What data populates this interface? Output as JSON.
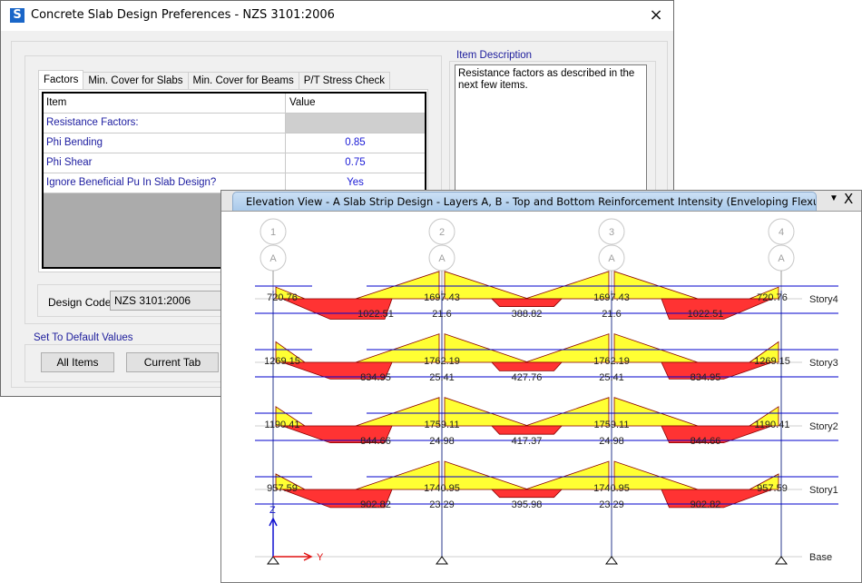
{
  "dialog": {
    "icon": "S",
    "title": "Concrete Slab Design Preferences - NZS 3101:2006",
    "close_icon": "×",
    "tabs": [
      {
        "label": "Factors",
        "active": true
      },
      {
        "label": "Min. Cover for Slabs",
        "active": false
      },
      {
        "label": "Min. Cover for Beams",
        "active": false
      },
      {
        "label": "P/T Stress Check",
        "active": false
      }
    ],
    "grid": {
      "headers": {
        "item": "Item",
        "value": "Value"
      },
      "rows": [
        {
          "item": "Resistance Factors:",
          "value": ""
        },
        {
          "item": "Phi Bending",
          "value": "0.85"
        },
        {
          "item": "Phi Shear",
          "value": "0.75"
        },
        {
          "item": "Ignore Beneficial Pu In Slab Design?",
          "value": "Yes"
        }
      ]
    },
    "item_description": {
      "label": "Item Description",
      "text": "Resistance factors as described in the next few items."
    },
    "design_code": {
      "label": "Design Code",
      "value": "NZS 3101:2006"
    },
    "defaults": {
      "label": "Set To Default Values",
      "all_items": "All Items",
      "current_tab": "Current Tab"
    }
  },
  "elevation": {
    "title": "Elevation View - A  Slab Strip Design - Layers A, B - Top and Bottom Reinforcement Intensity (Enveloping Flexural) ...",
    "dropdown_icon": "▼",
    "close_icon": "X",
    "grid_lines": [
      {
        "number": "1",
        "letter": "A"
      },
      {
        "number": "2",
        "letter": "A"
      },
      {
        "number": "3",
        "letter": "A"
      },
      {
        "number": "4",
        "letter": "A"
      }
    ],
    "axes": {
      "z": "Z",
      "y": "Y"
    },
    "base_label": "Base",
    "stories": [
      {
        "name": "Story4",
        "top": [
          "720.76",
          "1697.43",
          "1697.43",
          "720.76"
        ],
        "bottom": [
          "1022.51",
          "388.82",
          "1022.51"
        ],
        "support_bottom": [
          "21.6",
          "21.6"
        ]
      },
      {
        "name": "Story3",
        "top": [
          "1269.15",
          "1762.19",
          "1762.19",
          "1269.15"
        ],
        "bottom": [
          "834.95",
          "427.76",
          "834.95"
        ],
        "support_bottom": [
          "25.41",
          "25.41"
        ]
      },
      {
        "name": "Story2",
        "top": [
          "1190.41",
          "1759.11",
          "1759.11",
          "1190.41"
        ],
        "bottom": [
          "844.66",
          "417.37",
          "844.66"
        ],
        "support_bottom": [
          "24.98",
          "24.98"
        ]
      },
      {
        "name": "Story1",
        "top": [
          "957.59",
          "1740.95",
          "1740.95",
          "957.59"
        ],
        "bottom": [
          "902.82",
          "395.98",
          "902.82"
        ],
        "support_bottom": [
          "23.29",
          "23.29"
        ]
      }
    ],
    "colors": {
      "top": "#ffff33",
      "bottom": "#ff3333",
      "outline": "#8b0000",
      "strip_line": "#0000cc",
      "column": "#2a3a8c"
    }
  }
}
